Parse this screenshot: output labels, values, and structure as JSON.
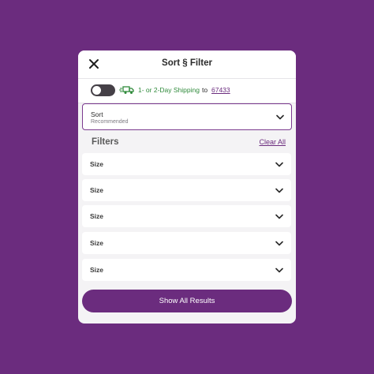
{
  "header": {
    "title": "Sort § Filter",
    "close_icon": "close-icon"
  },
  "shipping": {
    "toggle_on": false,
    "label": "1- or 2-Day Shipping",
    "to": "to",
    "zip": "67433",
    "icon": "truck-icon",
    "color": "#2f8a3b"
  },
  "sort": {
    "label": "Sort",
    "value": "Recommended"
  },
  "filters": {
    "heading": "Filters",
    "clear_all": "Clear All",
    "items": [
      {
        "label": "Size"
      },
      {
        "label": "Size"
      },
      {
        "label": "Size"
      },
      {
        "label": "Size"
      },
      {
        "label": "Size"
      }
    ]
  },
  "footer": {
    "show_results": "Show All Results"
  },
  "colors": {
    "brand": "#6b2c7e",
    "shipping_green": "#2f8a3b"
  }
}
